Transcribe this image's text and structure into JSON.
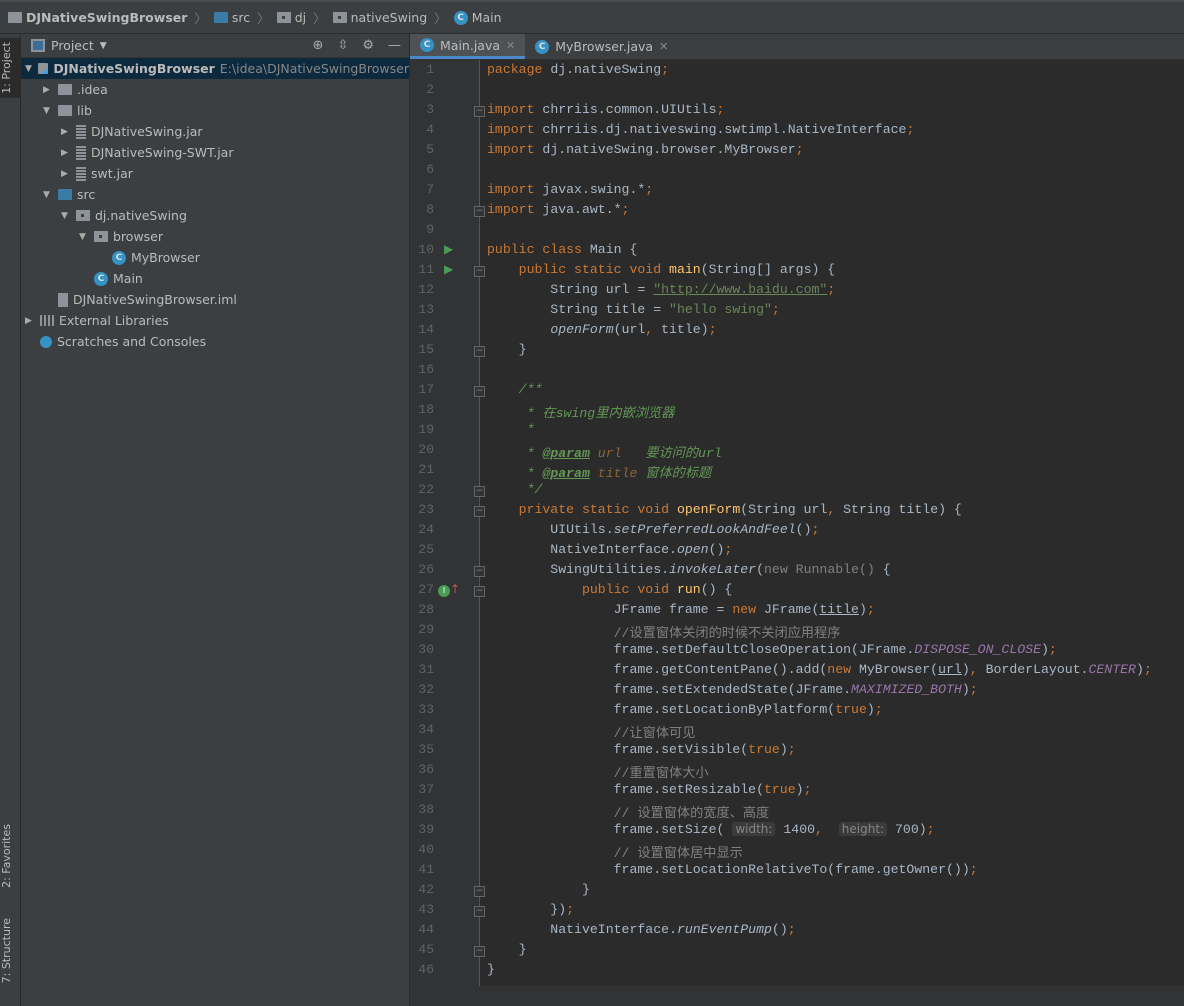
{
  "breadcrumb": [
    "DJNativeSwingBrowser",
    "src",
    "dj",
    "nativeSwing",
    "Main"
  ],
  "side_tabs": [
    "1: Project",
    "2: Favorites",
    "7: Structure"
  ],
  "project_panel": {
    "title": "Project",
    "tree": [
      {
        "label": "DJNativeSwingBrowser",
        "hint": "E:\\idea\\DJNativeSwingBrowser",
        "depth": 0,
        "arrow": "down",
        "icon": "module",
        "bold": true,
        "selected": true
      },
      {
        "label": ".idea",
        "depth": 1,
        "arrow": "right",
        "icon": "folder"
      },
      {
        "label": "lib",
        "depth": 1,
        "arrow": "down",
        "icon": "folder"
      },
      {
        "label": "DJNativeSwing.jar",
        "depth": 2,
        "arrow": "right",
        "icon": "jar"
      },
      {
        "label": "DJNativeSwing-SWT.jar",
        "depth": 2,
        "arrow": "right",
        "icon": "jar"
      },
      {
        "label": "swt.jar",
        "depth": 2,
        "arrow": "right",
        "icon": "jar"
      },
      {
        "label": "src",
        "depth": 1,
        "arrow": "down",
        "icon": "src"
      },
      {
        "label": "dj.nativeSwing",
        "depth": 2,
        "arrow": "down",
        "icon": "pkg"
      },
      {
        "label": "browser",
        "depth": 3,
        "arrow": "down",
        "icon": "pkg"
      },
      {
        "label": "MyBrowser",
        "depth": 4,
        "arrow": "",
        "icon": "class"
      },
      {
        "label": "Main",
        "depth": 3,
        "arrow": "",
        "icon": "class"
      },
      {
        "label": "DJNativeSwingBrowser.iml",
        "depth": 1,
        "arrow": "",
        "icon": "file"
      },
      {
        "label": "External Libraries",
        "depth": 0,
        "arrow": "right",
        "icon": "lib"
      },
      {
        "label": "Scratches and Consoles",
        "depth": 0,
        "arrow": "",
        "icon": "scratch"
      }
    ]
  },
  "tabs": [
    {
      "label": "Main.java",
      "active": true
    },
    {
      "label": "MyBrowser.java",
      "active": false
    }
  ],
  "code": [
    [
      [
        "k",
        "package "
      ],
      [
        "p",
        "dj.nativeSwing"
      ],
      [
        "k",
        ";"
      ]
    ],
    [],
    [
      [
        "k",
        "import "
      ],
      [
        "p",
        "chrriis.common.UIUtils"
      ],
      [
        "k",
        ";"
      ]
    ],
    [
      [
        "k",
        "import "
      ],
      [
        "p",
        "chrriis.dj.nativeswing.swtimpl.NativeInterface"
      ],
      [
        "k",
        ";"
      ]
    ],
    [
      [
        "k",
        "import "
      ],
      [
        "p",
        "dj.nativeSwing.browser.MyBrowser"
      ],
      [
        "k",
        ";"
      ]
    ],
    [],
    [
      [
        "k",
        "import "
      ],
      [
        "p",
        "javax.swing.*"
      ],
      [
        "k",
        ";"
      ]
    ],
    [
      [
        "k",
        "import "
      ],
      [
        "p",
        "java.awt.*"
      ],
      [
        "k",
        ";"
      ]
    ],
    [],
    [
      [
        "k",
        "public class "
      ],
      [
        "p",
        "Main {"
      ]
    ],
    [
      [
        "k",
        "    public static void "
      ],
      [
        "m",
        "main"
      ],
      [
        "p",
        "(String[] args) {"
      ]
    ],
    [
      [
        "p",
        "        String url = "
      ],
      [
        "su",
        "\"http://www.baidu.com\""
      ],
      [
        "k",
        ";"
      ]
    ],
    [
      [
        "p",
        "        String title = "
      ],
      [
        "s",
        "\"hello swing\""
      ],
      [
        "k",
        ";"
      ]
    ],
    [
      [
        "p",
        "        "
      ],
      [
        "i",
        "openForm"
      ],
      [
        "p",
        "(url"
      ],
      [
        "k",
        ", "
      ],
      [
        "p",
        "title)"
      ],
      [
        "k",
        ";"
      ]
    ],
    [
      [
        "p",
        "    }"
      ]
    ],
    [],
    [
      [
        "d",
        "    /**"
      ]
    ],
    [
      [
        "d",
        "     * 在swing里内嵌浏览器"
      ]
    ],
    [
      [
        "d",
        "     *"
      ]
    ],
    [
      [
        "d",
        "     * "
      ],
      [
        "dt",
        "@param"
      ],
      [
        "dp",
        " url"
      ],
      [
        "d",
        "   要访问的url"
      ]
    ],
    [
      [
        "d",
        "     * "
      ],
      [
        "dt",
        "@param"
      ],
      [
        "dp",
        " title"
      ],
      [
        "d",
        " 窗体的标题"
      ]
    ],
    [
      [
        "d",
        "     */"
      ]
    ],
    [
      [
        "k",
        "    private static void "
      ],
      [
        "m",
        "openForm"
      ],
      [
        "p",
        "(String url"
      ],
      [
        "k",
        ", "
      ],
      [
        "p",
        "String title) {"
      ]
    ],
    [
      [
        "p",
        "        UIUtils."
      ],
      [
        "i",
        "setPreferredLookAndFeel"
      ],
      [
        "p",
        "()"
      ],
      [
        "k",
        ";"
      ]
    ],
    [
      [
        "p",
        "        NativeInterface."
      ],
      [
        "i",
        "open"
      ],
      [
        "p",
        "()"
      ],
      [
        "k",
        ";"
      ]
    ],
    [
      [
        "p",
        "        SwingUtilities."
      ],
      [
        "i",
        "invokeLater"
      ],
      [
        "p",
        "("
      ],
      [
        "g",
        "new Runnable() "
      ],
      [
        "p",
        "{"
      ]
    ],
    [
      [
        "k",
        "            public void "
      ],
      [
        "m",
        "run"
      ],
      [
        "p",
        "() {"
      ]
    ],
    [
      [
        "p",
        "                JFrame frame = "
      ],
      [
        "k",
        "new "
      ],
      [
        "p",
        "JFrame("
      ],
      [
        "u",
        "title"
      ],
      [
        "p",
        ")"
      ],
      [
        "k",
        ";"
      ]
    ],
    [
      [
        "c",
        "                //设置窗体关闭的时候不关闭应用程序"
      ]
    ],
    [
      [
        "p",
        "                frame.setDefaultCloseOperation(JFrame."
      ],
      [
        "f",
        "DISPOSE_ON_CLOSE"
      ],
      [
        "p",
        ")"
      ],
      [
        "k",
        ";"
      ]
    ],
    [
      [
        "p",
        "                frame.getContentPane().add("
      ],
      [
        "k",
        "new "
      ],
      [
        "p",
        "MyBrowser("
      ],
      [
        "u",
        "url"
      ],
      [
        "p",
        ")"
      ],
      [
        "k",
        ", "
      ],
      [
        "p",
        "BorderLayout."
      ],
      [
        "f",
        "CENTER"
      ],
      [
        "p",
        ")"
      ],
      [
        "k",
        ";"
      ]
    ],
    [
      [
        "p",
        "                frame.setExtendedState(JFrame."
      ],
      [
        "f",
        "MAXIMIZED_BOTH"
      ],
      [
        "p",
        ")"
      ],
      [
        "k",
        ";"
      ]
    ],
    [
      [
        "p",
        "                frame.setLocationByPlatform("
      ],
      [
        "k",
        "true"
      ],
      [
        "p",
        ")"
      ],
      [
        "k",
        ";"
      ]
    ],
    [
      [
        "c",
        "                //让窗体可见"
      ]
    ],
    [
      [
        "p",
        "                frame.setVisible("
      ],
      [
        "k",
        "true"
      ],
      [
        "p",
        ")"
      ],
      [
        "k",
        ";"
      ]
    ],
    [
      [
        "c",
        "                //重置窗体大小"
      ]
    ],
    [
      [
        "p",
        "                frame.setResizable("
      ],
      [
        "k",
        "true"
      ],
      [
        "p",
        ")"
      ],
      [
        "k",
        ";"
      ]
    ],
    [
      [
        "c",
        "                // 设置窗体的宽度、高度"
      ]
    ],
    [
      [
        "p",
        "                frame.setSize( "
      ],
      [
        "h",
        "width:"
      ],
      [
        "p",
        " 1400"
      ],
      [
        "k",
        ",  "
      ],
      [
        "h",
        "height:"
      ],
      [
        "p",
        " 700)"
      ],
      [
        "k",
        ";"
      ]
    ],
    [
      [
        "c",
        "                // 设置窗体居中显示"
      ]
    ],
    [
      [
        "p",
        "                frame.setLocationRelativeTo(frame.getOwner())"
      ],
      [
        "k",
        ";"
      ]
    ],
    [
      [
        "p",
        "            }"
      ]
    ],
    [
      [
        "p",
        "        })"
      ],
      [
        "k",
        ";"
      ]
    ],
    [
      [
        "p",
        "        NativeInterface."
      ],
      [
        "i",
        "runEventPump"
      ],
      [
        "p",
        "()"
      ],
      [
        "k",
        ";"
      ]
    ],
    [
      [
        "p",
        "    }"
      ]
    ],
    [
      [
        "p",
        "}"
      ]
    ]
  ]
}
